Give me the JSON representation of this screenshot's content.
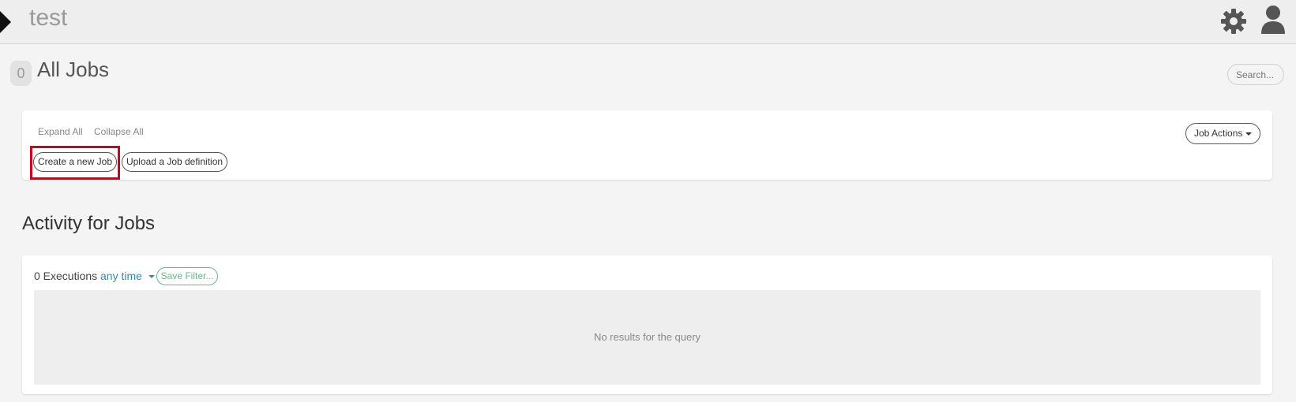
{
  "header": {
    "project_title": "test",
    "icons": [
      "sidebar-toggle-icon",
      "gear-icon",
      "user-icon"
    ]
  },
  "jobs": {
    "count": "0",
    "title": "All Jobs",
    "search_placeholder": "Search...",
    "expand_all": "Expand All",
    "collapse_all": "Collapse All",
    "create_job": "Create a new Job",
    "upload_job": "Upload a Job definition",
    "job_actions": "Job Actions"
  },
  "activity": {
    "title": "Activity for Jobs",
    "executions": "0 Executions",
    "time_filter": "any time",
    "save_filter": "Save Filter...",
    "empty_message": "No results for the query"
  },
  "colors": {
    "highlight": "#d0021b",
    "link_blue": "#3c89a5",
    "filter_green": "#6ab88a"
  }
}
